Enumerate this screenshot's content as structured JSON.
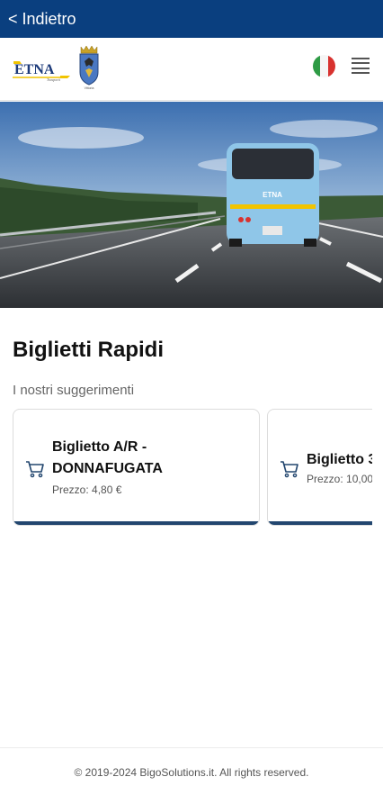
{
  "topbar": {
    "back_label": "< Indietro",
    "background": "#0a3f7f"
  },
  "header": {
    "logo_text": "ETNA",
    "logo_subtext": "Trasporti",
    "crest_caption": "Vittoria",
    "language": "Italiano",
    "flag_colors": [
      "#2e9b45",
      "#ffffff",
      "#d8322f"
    ]
  },
  "hero": {
    "image_subject": "bus-on-highway",
    "bus_text": "ETNA"
  },
  "main": {
    "title": "Biglietti Rapidi",
    "subtitle": "I nostri suggerimenti",
    "accent_color": "#22466f",
    "cards": [
      {
        "title": "Biglietto A/R - DONNAFUGATA",
        "price": "Prezzo: 4,80 €",
        "icon": "cart-icon"
      },
      {
        "title": "Biglietto 3",
        "price": "Prezzo: 10,00",
        "icon": "cart-icon"
      }
    ]
  },
  "footer": {
    "copyright": "© 2019-2024 BigoSolutions.it. All rights reserved."
  }
}
